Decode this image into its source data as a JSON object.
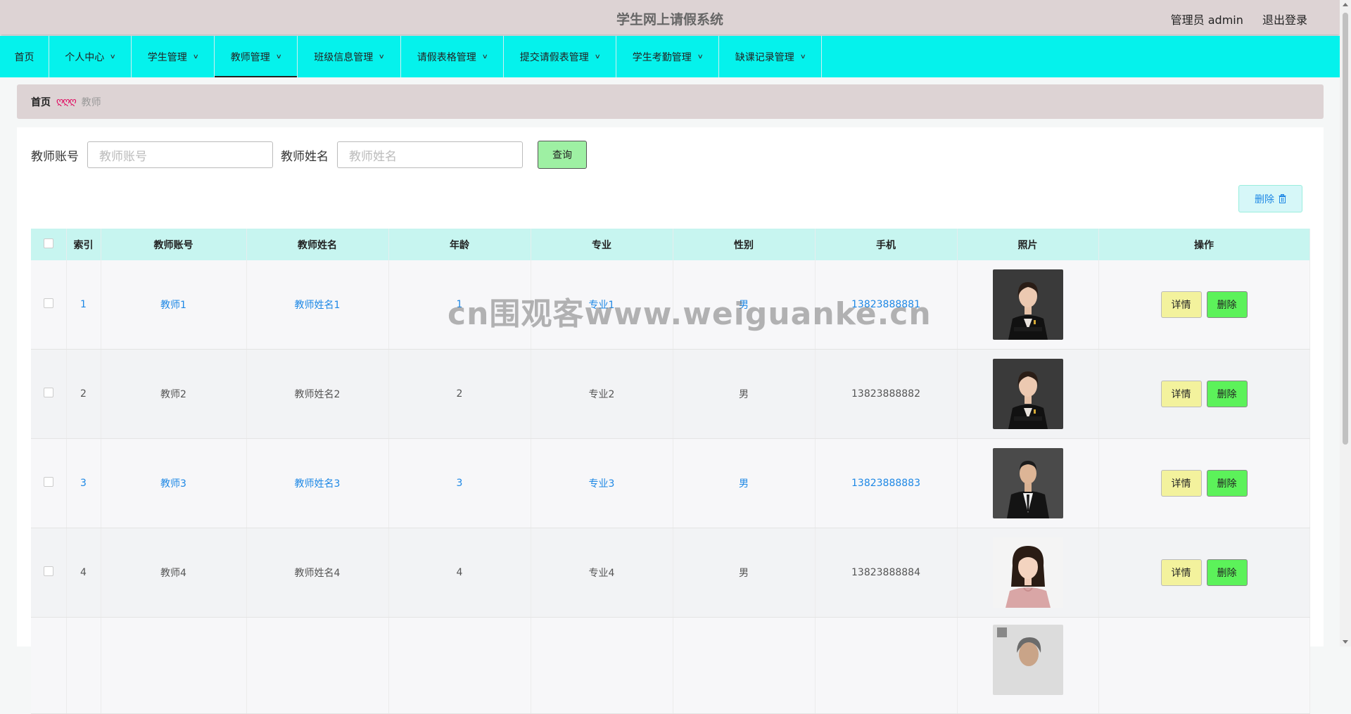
{
  "header": {
    "title": "学生网上请假系统",
    "user_label": "管理员 admin",
    "logout_label": "退出登录"
  },
  "nav": {
    "items": [
      {
        "label": "首页",
        "has_dropdown": false
      },
      {
        "label": "个人中心",
        "has_dropdown": true
      },
      {
        "label": "学生管理",
        "has_dropdown": true
      },
      {
        "label": "教师管理",
        "has_dropdown": true,
        "active": true
      },
      {
        "label": "班级信息管理",
        "has_dropdown": true
      },
      {
        "label": "请假表格管理",
        "has_dropdown": true
      },
      {
        "label": "提交请假表管理",
        "has_dropdown": true
      },
      {
        "label": "学生考勤管理",
        "has_dropdown": true
      },
      {
        "label": "缺课记录管理",
        "has_dropdown": true
      }
    ]
  },
  "breadcrumb": {
    "home": "首页",
    "separator": "ღღღ",
    "current": "教师"
  },
  "search": {
    "account_label": "教师账号",
    "account_placeholder": "教师账号",
    "name_label": "教师姓名",
    "name_placeholder": "教师姓名",
    "query_label": "查询"
  },
  "toolbar": {
    "delete_label": "删除",
    "delete_icon": "trash-icon"
  },
  "table": {
    "columns": [
      "索引",
      "教师账号",
      "教师姓名",
      "年龄",
      "专业",
      "性别",
      "手机",
      "照片",
      "操作"
    ],
    "rows": [
      {
        "index": "1",
        "account": "教师1",
        "name": "教师姓名1",
        "age": "1",
        "major": "专业1",
        "gender": "男",
        "phone": "13823888881",
        "photo": "woman-black-blazer"
      },
      {
        "index": "2",
        "account": "教师2",
        "name": "教师姓名2",
        "age": "2",
        "major": "专业2",
        "gender": "男",
        "phone": "13823888882",
        "photo": "woman-black-blazer"
      },
      {
        "index": "3",
        "account": "教师3",
        "name": "教师姓名3",
        "age": "3",
        "major": "专业3",
        "gender": "男",
        "phone": "13823888883",
        "photo": "man-black-suit"
      },
      {
        "index": "4",
        "account": "教师4",
        "name": "教师姓名4",
        "age": "4",
        "major": "专业4",
        "gender": "男",
        "phone": "13823888884",
        "photo": "woman-pink-blouse"
      },
      {
        "index": "",
        "account": "",
        "name": "",
        "age": "",
        "major": "",
        "gender": "",
        "phone": "",
        "photo": "man-gray-partial"
      }
    ],
    "detail_label": "详情",
    "delete_label": "删除"
  },
  "watermark": "cn围观客www.weiguanke.cn",
  "colors": {
    "header_bg": "#ddd3d4",
    "nav_bg": "#05f2ec",
    "table_header_bg": "#c7f5f0",
    "link_blue": "#1e88e5",
    "query_button": "#9ef0a3",
    "detail_button": "#f3f29d",
    "delete_button": "#5cf25a"
  }
}
